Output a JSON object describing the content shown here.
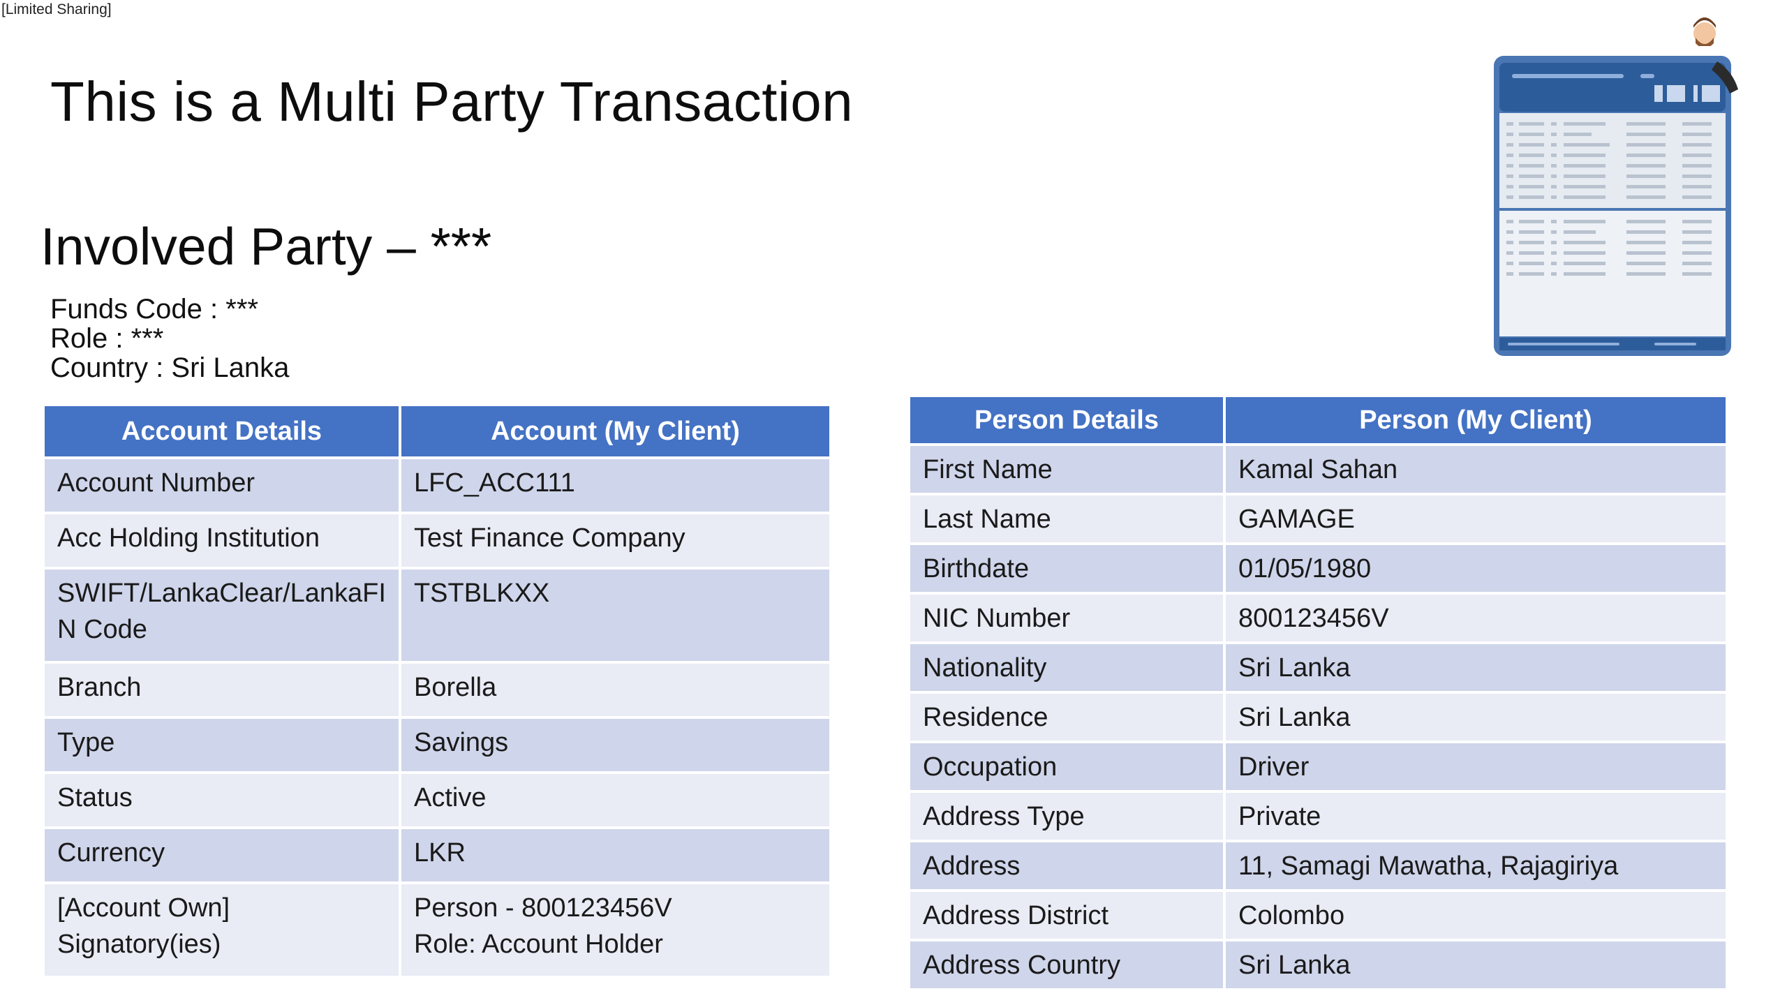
{
  "banner": "[Limited Sharing]",
  "title": "This is a Multi Party Transaction",
  "party": {
    "heading": "Involved Party – ***",
    "funds_code": "Funds Code : ***",
    "role": "Role : ***",
    "country": "Country : Sri Lanka"
  },
  "account_table": {
    "headers": [
      "Account Details",
      "Account (My Client)"
    ],
    "rows": [
      {
        "label": "Account Number",
        "value": "LFC_ACC111"
      },
      {
        "label": "Acc Holding Institution",
        "value": "Test Finance Company"
      },
      {
        "label": "SWIFT/LankaClear/LankaFI N Code",
        "value": "TSTBLKXX"
      },
      {
        "label": "Branch",
        "value": "Borella"
      },
      {
        "label": "Type",
        "value": "Savings"
      },
      {
        "label": "Status",
        "value": "Active"
      },
      {
        "label": "Currency",
        "value": "LKR"
      },
      {
        "label": "[Account Own] Signatory(ies)",
        "value": "Person - 800123456V\nRole: Account Holder"
      }
    ]
  },
  "person_table": {
    "headers": [
      "Person Details",
      "Person (My Client)"
    ],
    "rows": [
      {
        "label": "First Name",
        "value": "Kamal Sahan"
      },
      {
        "label": "Last Name",
        "value": "GAMAGE"
      },
      {
        "label": "Birthdate",
        "value": "01/05/1980"
      },
      {
        "label": "NIC Number",
        "value": "800123456V"
      },
      {
        "label": "Nationality",
        "value": "Sri Lanka"
      },
      {
        "label": "Residence",
        "value": "Sri Lanka"
      },
      {
        "label": "Occupation",
        "value": "Driver"
      },
      {
        "label": "Address Type",
        "value": "Private"
      },
      {
        "label": "Address",
        "value": "11, Samagi Mawatha, Rajagiriya"
      },
      {
        "label": "Address District",
        "value": "Colombo"
      },
      {
        "label": "Address Country",
        "value": "Sri Lanka"
      }
    ]
  },
  "illustration": {
    "icon": "presenter-with-spreadsheet-icon",
    "colors": {
      "frame": "#4a76b3",
      "header": "#2d5c9a",
      "body": "#e6ebf2",
      "lines": "#b9c2cf"
    }
  }
}
